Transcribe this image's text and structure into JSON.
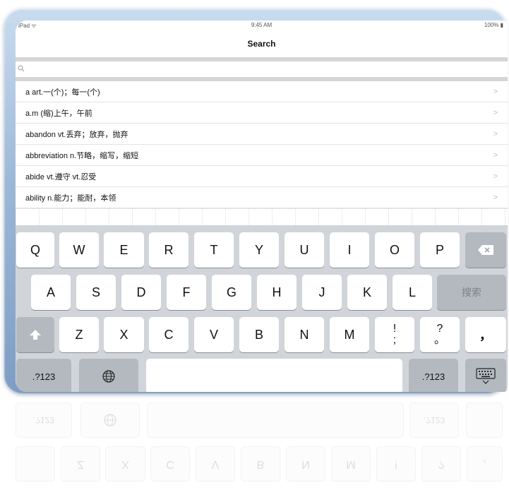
{
  "statusbar": {
    "left": "iPad ᯤ",
    "center": "9:45 AM",
    "right": "100% ▮"
  },
  "navbar": {
    "title": "Search"
  },
  "search": {
    "placeholder": ""
  },
  "list": {
    "items": [
      {
        "label": "a art.一(个)；每一(个)"
      },
      {
        "label": "a.m (缩)上午，午前"
      },
      {
        "label": "abandon vt.丢弃；放弃，抛弃"
      },
      {
        "label": "abbreviation n.节略，缩写，缩短"
      },
      {
        "label": "abide vt.遵守 vt.忍受"
      },
      {
        "label": "ability n.能力；能耐，本领"
      }
    ],
    "chevron": ">"
  },
  "keyboard": {
    "row1": [
      "Q",
      "W",
      "E",
      "R",
      "T",
      "Y",
      "U",
      "I",
      "O",
      "P"
    ],
    "row2": [
      "A",
      "S",
      "D",
      "F",
      "G",
      "H",
      "J",
      "K",
      "L"
    ],
    "search_key": "搜索",
    "row3": [
      "Z",
      "X",
      "C",
      "V",
      "B",
      "N",
      "M"
    ],
    "punct1_top": "!",
    "punct1_bottom": ";",
    "punct2_top": "?",
    "punct2_bottom": "。",
    "comma": "，",
    "numbers_left": ".?123",
    "numbers_right": ".?123",
    "globe_icon": "globe-icon",
    "backspace_icon": "backspace-icon",
    "shift_icon": "shift-icon",
    "hide_icon": "keyboard-hide-icon"
  },
  "reflection": {
    "row_a": [
      ".?123",
      "",
      "",
      ".?123",
      ""
    ],
    "row_b": [
      "",
      "Z",
      "X",
      "C",
      "V",
      "B",
      "N",
      "M",
      "!",
      "?",
      ","
    ]
  }
}
